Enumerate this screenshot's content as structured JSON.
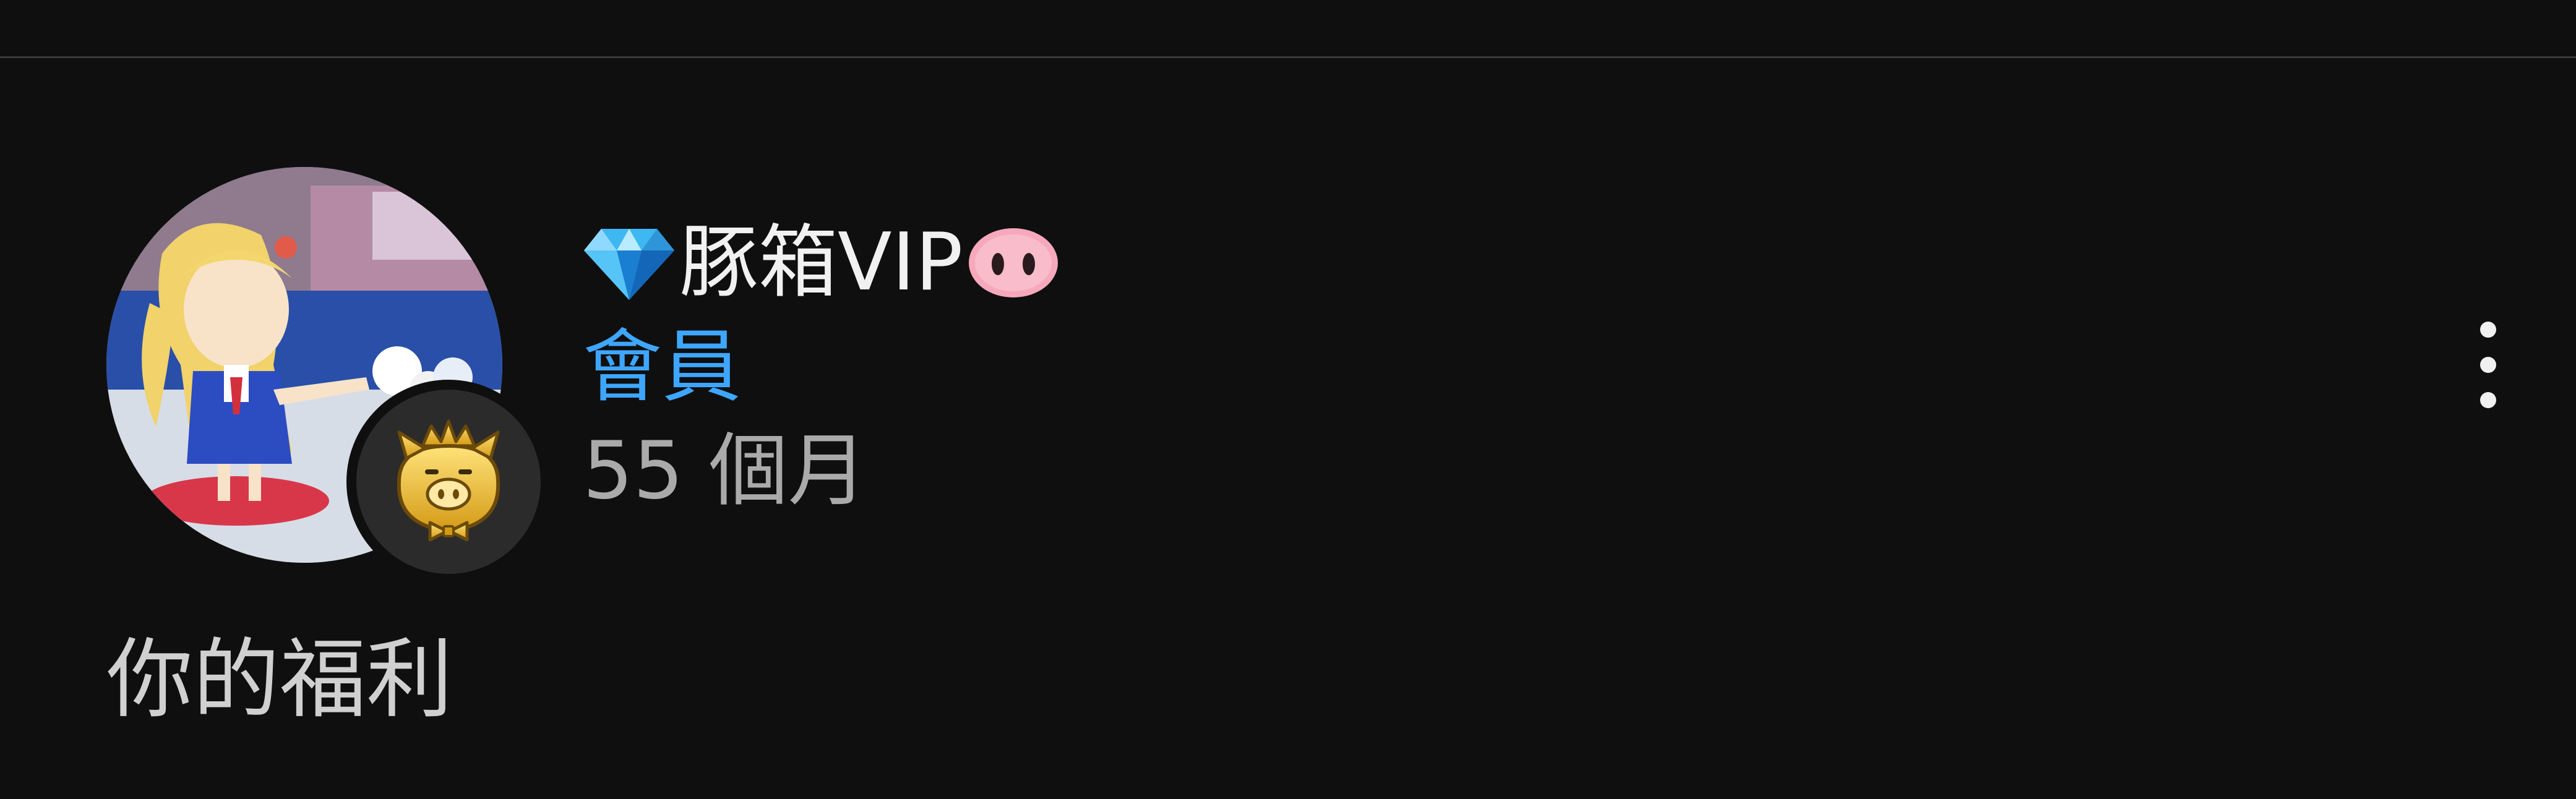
{
  "membership": {
    "title_text": "豚箱VIP",
    "title_prefix_icon": "diamond-icon",
    "title_suffix_icon": "pig-nose-icon",
    "member_label": "會員",
    "duration": "55 個月",
    "badge_icon": "golden-pig-crown-badge",
    "more_icon": "more-vertical-icon"
  },
  "benefits": {
    "heading": "你的福利"
  },
  "colors": {
    "background": "#0f0f0f",
    "accent": "#3ea6ff",
    "primary_text": "#f1f1f1",
    "secondary_text": "#aaaaaa"
  }
}
